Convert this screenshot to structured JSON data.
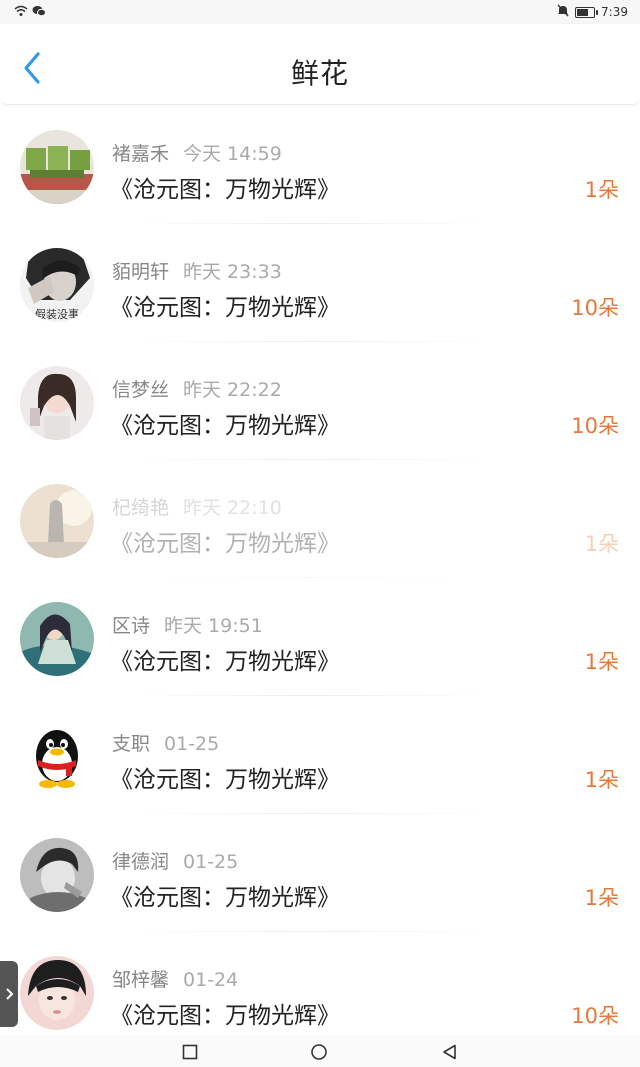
{
  "status_bar": {
    "time": "7:39",
    "battery_level": 0.7,
    "left_icons": [
      "wifi-icon",
      "wechat-icon"
    ],
    "right_icons": [
      "mute-icon",
      "battery-icon"
    ]
  },
  "header": {
    "title": "鲜花",
    "back_icon": "chevron-left-icon",
    "accent_color": "#2e9bea"
  },
  "colors": {
    "count": "#e8773a",
    "name": "#888888"
  },
  "records": [
    {
      "name": "褚嘉禾",
      "time": "今天 14:59",
      "book": "《沧元图：万物光辉》",
      "count": "1朵"
    },
    {
      "name": "貊明轩",
      "time": "昨天 23:33",
      "book": "《沧元图：万物光辉》",
      "count": "10朵"
    },
    {
      "name": "信梦丝",
      "time": "昨天 22:22",
      "book": "《沧元图：万物光辉》",
      "count": "10朵"
    },
    {
      "name": "杞绮艳",
      "time": "昨天 22:10",
      "book": "《沧元图：万物光辉》",
      "count": "1朵"
    },
    {
      "name": "区诗",
      "time": "昨天 19:51",
      "book": "《沧元图：万物光辉》",
      "count": "1朵"
    },
    {
      "name": "支职",
      "time": "01-25",
      "book": "《沧元图：万物光辉》",
      "count": "1朵"
    },
    {
      "name": "律德润",
      "time": "01-25",
      "book": "《沧元图：万物光辉》",
      "count": "1朵"
    },
    {
      "name": "邹梓馨",
      "time": "01-24",
      "book": "《沧元图：万物光辉》",
      "count": "10朵"
    }
  ],
  "avatar_overlay_text": "假装没事",
  "side_tab_icon": "chevron-right-icon",
  "nav_bar": {
    "icons": [
      "recents-square-icon",
      "home-circle-icon",
      "back-triangle-icon"
    ]
  }
}
